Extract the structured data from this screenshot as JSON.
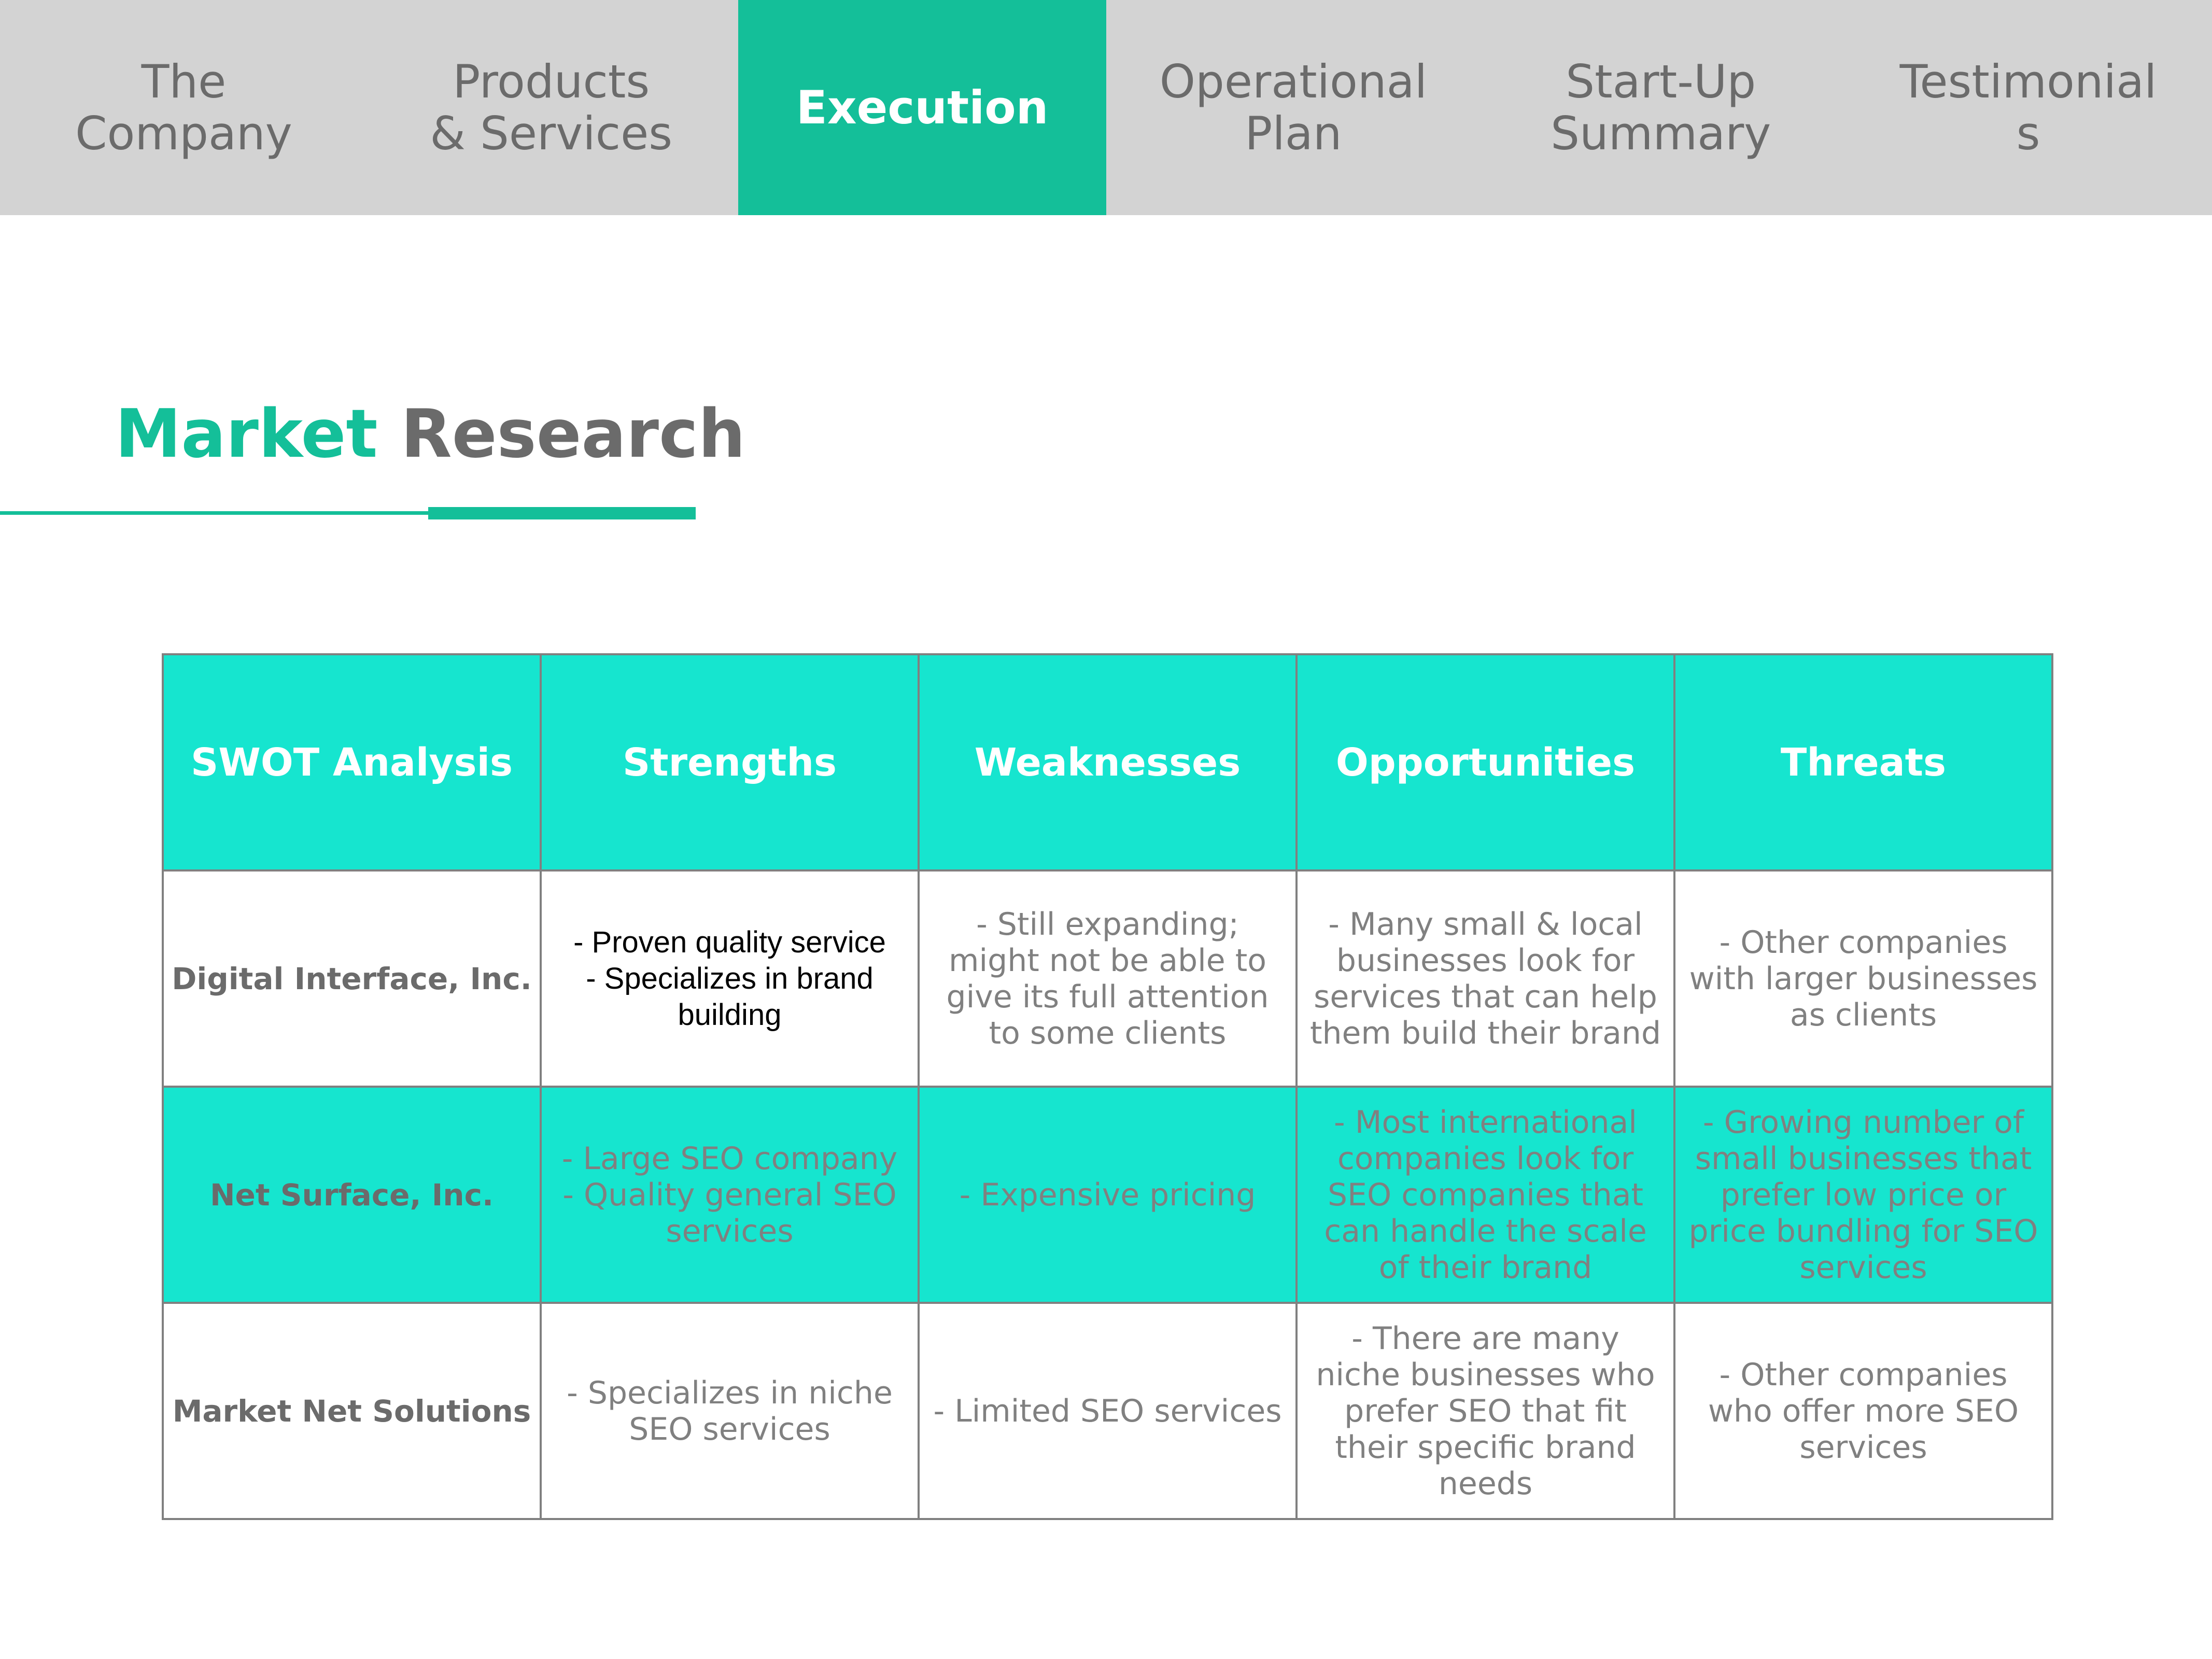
{
  "nav": {
    "tabs": [
      {
        "lines": [
          "The",
          "Company"
        ],
        "active": false
      },
      {
        "lines": [
          "Products",
          "& Services"
        ],
        "active": false
      },
      {
        "lines": [
          "Execution"
        ],
        "active": true
      },
      {
        "lines": [
          "Operational",
          "Plan"
        ],
        "active": false
      },
      {
        "lines": [
          "Start-Up",
          "Summary"
        ],
        "active": false
      },
      {
        "lines": [
          "Testimonial",
          "s"
        ],
        "active": false
      }
    ]
  },
  "title": {
    "accent": "Market",
    "main": "Research"
  },
  "swot": {
    "headers": [
      "SWOT Analysis",
      "Strengths",
      "Weaknesses",
      "Opportunities",
      "Threats"
    ],
    "rows": [
      {
        "company": "Digital Interface, Inc.",
        "strengths": [
          "- Proven quality service",
          "- Specializes in brand building"
        ],
        "weaknesses": [
          "- Still expanding; might not be able to give its full attention to some clients"
        ],
        "opportunities": [
          "- Many small & local businesses look for services that can help them build their brand"
        ],
        "threats": [
          "- Other companies with  larger businesses as clients"
        ]
      },
      {
        "company": "Net Surface, Inc.",
        "strengths": [
          "- Large SEO company",
          "- Quality general SEO services"
        ],
        "weaknesses": [
          "- Expensive pricing"
        ],
        "opportunities": [
          "- Most international companies look for SEO companies that can handle the scale of their brand"
        ],
        "threats": [
          "- Growing number of small businesses that prefer low price or price bundling for SEO services"
        ]
      },
      {
        "company": "Market Net Solutions",
        "strengths": [
          "- Specializes in  niche SEO services"
        ],
        "weaknesses": [
          "- Limited SEO services"
        ],
        "opportunities": [
          "- There are many niche businesses who prefer SEO that fit their specific brand needs"
        ],
        "threats": [
          "- Other companies who offer more SEO services"
        ]
      }
    ]
  },
  "colors": {
    "accent": "#14bf99",
    "table_teal": "#16e5cf",
    "nav_bg": "#d3d3d3",
    "text_gray": "#6b6b6b"
  }
}
